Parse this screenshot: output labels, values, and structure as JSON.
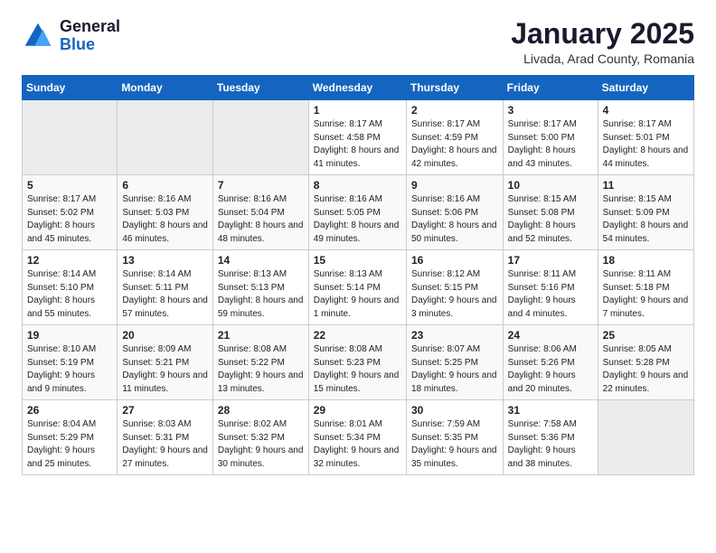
{
  "header": {
    "logo_general": "General",
    "logo_blue": "Blue",
    "month_title": "January 2025",
    "location": "Livada, Arad County, Romania"
  },
  "weekdays": [
    "Sunday",
    "Monday",
    "Tuesday",
    "Wednesday",
    "Thursday",
    "Friday",
    "Saturday"
  ],
  "weeks": [
    [
      {
        "day": "",
        "info": ""
      },
      {
        "day": "",
        "info": ""
      },
      {
        "day": "",
        "info": ""
      },
      {
        "day": "1",
        "info": "Sunrise: 8:17 AM\nSunset: 4:58 PM\nDaylight: 8 hours and 41 minutes."
      },
      {
        "day": "2",
        "info": "Sunrise: 8:17 AM\nSunset: 4:59 PM\nDaylight: 8 hours and 42 minutes."
      },
      {
        "day": "3",
        "info": "Sunrise: 8:17 AM\nSunset: 5:00 PM\nDaylight: 8 hours and 43 minutes."
      },
      {
        "day": "4",
        "info": "Sunrise: 8:17 AM\nSunset: 5:01 PM\nDaylight: 8 hours and 44 minutes."
      }
    ],
    [
      {
        "day": "5",
        "info": "Sunrise: 8:17 AM\nSunset: 5:02 PM\nDaylight: 8 hours and 45 minutes."
      },
      {
        "day": "6",
        "info": "Sunrise: 8:16 AM\nSunset: 5:03 PM\nDaylight: 8 hours and 46 minutes."
      },
      {
        "day": "7",
        "info": "Sunrise: 8:16 AM\nSunset: 5:04 PM\nDaylight: 8 hours and 48 minutes."
      },
      {
        "day": "8",
        "info": "Sunrise: 8:16 AM\nSunset: 5:05 PM\nDaylight: 8 hours and 49 minutes."
      },
      {
        "day": "9",
        "info": "Sunrise: 8:16 AM\nSunset: 5:06 PM\nDaylight: 8 hours and 50 minutes."
      },
      {
        "day": "10",
        "info": "Sunrise: 8:15 AM\nSunset: 5:08 PM\nDaylight: 8 hours and 52 minutes."
      },
      {
        "day": "11",
        "info": "Sunrise: 8:15 AM\nSunset: 5:09 PM\nDaylight: 8 hours and 54 minutes."
      }
    ],
    [
      {
        "day": "12",
        "info": "Sunrise: 8:14 AM\nSunset: 5:10 PM\nDaylight: 8 hours and 55 minutes."
      },
      {
        "day": "13",
        "info": "Sunrise: 8:14 AM\nSunset: 5:11 PM\nDaylight: 8 hours and 57 minutes."
      },
      {
        "day": "14",
        "info": "Sunrise: 8:13 AM\nSunset: 5:13 PM\nDaylight: 8 hours and 59 minutes."
      },
      {
        "day": "15",
        "info": "Sunrise: 8:13 AM\nSunset: 5:14 PM\nDaylight: 9 hours and 1 minute."
      },
      {
        "day": "16",
        "info": "Sunrise: 8:12 AM\nSunset: 5:15 PM\nDaylight: 9 hours and 3 minutes."
      },
      {
        "day": "17",
        "info": "Sunrise: 8:11 AM\nSunset: 5:16 PM\nDaylight: 9 hours and 4 minutes."
      },
      {
        "day": "18",
        "info": "Sunrise: 8:11 AM\nSunset: 5:18 PM\nDaylight: 9 hours and 7 minutes."
      }
    ],
    [
      {
        "day": "19",
        "info": "Sunrise: 8:10 AM\nSunset: 5:19 PM\nDaylight: 9 hours and 9 minutes."
      },
      {
        "day": "20",
        "info": "Sunrise: 8:09 AM\nSunset: 5:21 PM\nDaylight: 9 hours and 11 minutes."
      },
      {
        "day": "21",
        "info": "Sunrise: 8:08 AM\nSunset: 5:22 PM\nDaylight: 9 hours and 13 minutes."
      },
      {
        "day": "22",
        "info": "Sunrise: 8:08 AM\nSunset: 5:23 PM\nDaylight: 9 hours and 15 minutes."
      },
      {
        "day": "23",
        "info": "Sunrise: 8:07 AM\nSunset: 5:25 PM\nDaylight: 9 hours and 18 minutes."
      },
      {
        "day": "24",
        "info": "Sunrise: 8:06 AM\nSunset: 5:26 PM\nDaylight: 9 hours and 20 minutes."
      },
      {
        "day": "25",
        "info": "Sunrise: 8:05 AM\nSunset: 5:28 PM\nDaylight: 9 hours and 22 minutes."
      }
    ],
    [
      {
        "day": "26",
        "info": "Sunrise: 8:04 AM\nSunset: 5:29 PM\nDaylight: 9 hours and 25 minutes."
      },
      {
        "day": "27",
        "info": "Sunrise: 8:03 AM\nSunset: 5:31 PM\nDaylight: 9 hours and 27 minutes."
      },
      {
        "day": "28",
        "info": "Sunrise: 8:02 AM\nSunset: 5:32 PM\nDaylight: 9 hours and 30 minutes."
      },
      {
        "day": "29",
        "info": "Sunrise: 8:01 AM\nSunset: 5:34 PM\nDaylight: 9 hours and 32 minutes."
      },
      {
        "day": "30",
        "info": "Sunrise: 7:59 AM\nSunset: 5:35 PM\nDaylight: 9 hours and 35 minutes."
      },
      {
        "day": "31",
        "info": "Sunrise: 7:58 AM\nSunset: 5:36 PM\nDaylight: 9 hours and 38 minutes."
      },
      {
        "day": "",
        "info": ""
      }
    ]
  ]
}
